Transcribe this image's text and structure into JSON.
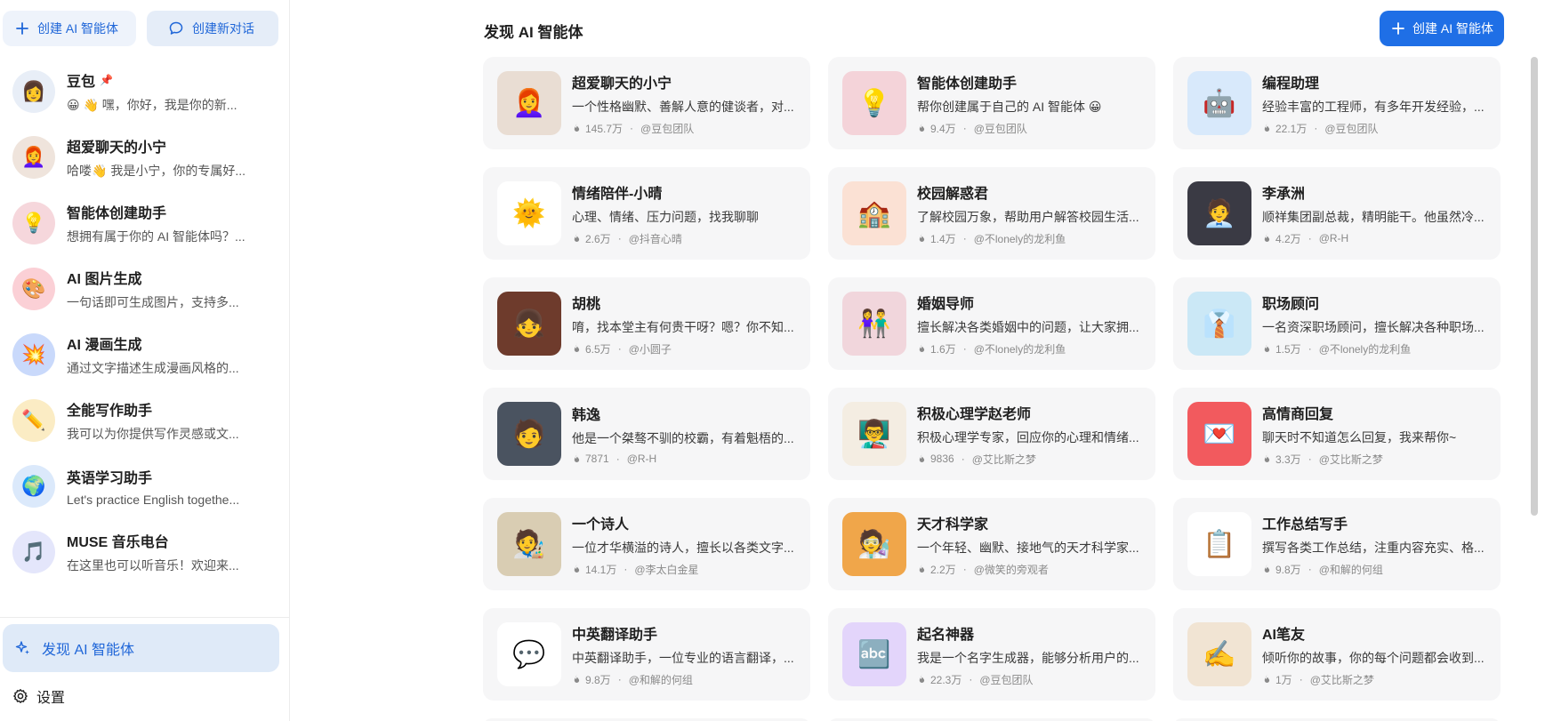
{
  "sidebar": {
    "create_agent_label": "创建 AI 智能体",
    "new_chat_label": "创建新对话",
    "chats": [
      {
        "name": "豆包",
        "preview": "😀 👋 嘿，你好，我是你的新...",
        "avatar": "👩",
        "bg": "#e8eef7",
        "pinned": true
      },
      {
        "name": "超爱聊天的小宁",
        "preview": "哈喽👋 我是小宁，你的专属好...",
        "avatar": "👩‍🦰",
        "bg": "#efe4dc",
        "pinned": false
      },
      {
        "name": "智能体创建助手",
        "preview": "想拥有属于你的 AI 智能体吗？...",
        "avatar": "💡",
        "bg": "#f6d7dc",
        "pinned": false
      },
      {
        "name": "AI 图片生成",
        "preview": "一句话即可生成图片，支持多...",
        "avatar": "🎨",
        "bg": "#fbd0d6",
        "pinned": false
      },
      {
        "name": "AI 漫画生成",
        "preview": "通过文字描述生成漫画风格的...",
        "avatar": "💥",
        "bg": "#c9d9fb",
        "pinned": false
      },
      {
        "name": "全能写作助手",
        "preview": "我可以为你提供写作灵感或文...",
        "avatar": "✏️",
        "bg": "#fbecc4",
        "pinned": false
      },
      {
        "name": "英语学习助手",
        "preview": "Let's practice English togethe...",
        "avatar": "🌍",
        "bg": "#dbe9fb",
        "pinned": false
      },
      {
        "name": "MUSE 音乐电台",
        "preview": "在这里也可以听音乐！欢迎来...",
        "avatar": "🎵",
        "bg": "#e4e6fb",
        "pinned": false
      }
    ],
    "discover_label": "发现 AI 智能体",
    "settings_label": "设置"
  },
  "main": {
    "title": "发现 AI 智能体",
    "create_button_label": "创建 AI 智能体",
    "cards": [
      {
        "title": "超爱聊天的小宁",
        "desc": "一个性格幽默、善解人意的健谈者，对...",
        "count": "145.7万",
        "author": "@豆包团队",
        "icon": "👩‍🦰",
        "bg": "#e9ddd3"
      },
      {
        "title": "智能体创建助手",
        "desc": "帮你创建属于自己的 AI 智能体 😀",
        "count": "9.4万",
        "author": "@豆包团队",
        "icon": "💡",
        "bg": "#f4d3d9"
      },
      {
        "title": "编程助理",
        "desc": "经验丰富的工程师，有多年开发经验，...",
        "count": "22.1万",
        "author": "@豆包团队",
        "icon": "🤖",
        "bg": "#d8e9fb"
      },
      {
        "title": "情绪陪伴-小晴",
        "desc": "心理、情绪、压力问题，找我聊聊",
        "count": "2.6万",
        "author": "@抖音心晴",
        "icon": "🌞",
        "bg": "#ffffff"
      },
      {
        "title": "校园解惑君",
        "desc": "了解校园万象，帮助用户解答校园生活...",
        "count": "1.4万",
        "author": "@不lonely的龙利鱼",
        "icon": "🏫",
        "bg": "#fbe1d4"
      },
      {
        "title": "李承洲",
        "desc": "顺祥集团副总裁，精明能干。他虽然冷...",
        "count": "4.2万",
        "author": "@R-H",
        "icon": "🧑‍💼",
        "bg": "#3a3a44"
      },
      {
        "title": "胡桃",
        "desc": "唷，找本堂主有何贵干呀？嗯？你不知...",
        "count": "6.5万",
        "author": "@小圆子",
        "icon": "👧",
        "bg": "#6e3b2c"
      },
      {
        "title": "婚姻导师",
        "desc": "擅长解决各类婚姻中的问题，让大家拥...",
        "count": "1.6万",
        "author": "@不lonely的龙利鱼",
        "icon": "👫",
        "bg": "#f1d6dc"
      },
      {
        "title": "职场顾问",
        "desc": "一名资深职场顾问，擅长解决各种职场...",
        "count": "1.5万",
        "author": "@不lonely的龙利鱼",
        "icon": "👔",
        "bg": "#cbe8f6"
      },
      {
        "title": "韩逸",
        "desc": "他是一个桀骜不驯的校霸，有着魁梧的...",
        "count": "7871",
        "author": "@R-H",
        "icon": "🧑",
        "bg": "#4a5360"
      },
      {
        "title": "积极心理学赵老师",
        "desc": "积极心理学专家，回应你的心理和情绪...",
        "count": "9836",
        "author": "@艾比斯之梦",
        "icon": "👨‍🏫",
        "bg": "#f4ede2"
      },
      {
        "title": "高情商回复",
        "desc": "聊天时不知道怎么回复，我来帮你~",
        "count": "3.3万",
        "author": "@艾比斯之梦",
        "icon": "💌",
        "bg": "#f25a5e"
      },
      {
        "title": "一个诗人",
        "desc": "一位才华横溢的诗人，擅长以各类文字...",
        "count": "14.1万",
        "author": "@李太白金星",
        "icon": "🧑‍🎨",
        "bg": "#d9cdb3"
      },
      {
        "title": "天才科学家",
        "desc": "一个年轻、幽默、接地气的天才科学家...",
        "count": "2.2万",
        "author": "@微笑的旁观者",
        "icon": "🧑‍🔬",
        "bg": "#f0a64a"
      },
      {
        "title": "工作总结写手",
        "desc": "撰写各类工作总结，注重内容充实、格...",
        "count": "9.8万",
        "author": "@和解的何组",
        "icon": "📋",
        "bg": "#ffffff"
      },
      {
        "title": "中英翻译助手",
        "desc": "中英翻译助手，一位专业的语言翻译，...",
        "count": "9.8万",
        "author": "@和解的何组",
        "icon": "💬",
        "bg": "#ffffff"
      },
      {
        "title": "起名神器",
        "desc": "我是一个名字生成器，能够分析用户的...",
        "count": "22.3万",
        "author": "@豆包团队",
        "icon": "🔤",
        "bg": "#e3d5fb"
      },
      {
        "title": "AI笔友",
        "desc": "倾听你的故事，你的每个问题都会收到...",
        "count": "1万",
        "author": "@艾比斯之梦",
        "icon": "✍️",
        "bg": "#f1e4d3"
      }
    ]
  },
  "colors": {
    "accent": "#1f6fe6",
    "accent_soft": "#dfeaf8",
    "card_bg": "#f6f6f7"
  },
  "icons": {
    "create": "plus-icon",
    "new_chat": "chat-bubble-icon",
    "discover": "sparkle-icon",
    "settings": "gear-icon",
    "pin": "pin-icon",
    "fire": "fire-icon"
  }
}
